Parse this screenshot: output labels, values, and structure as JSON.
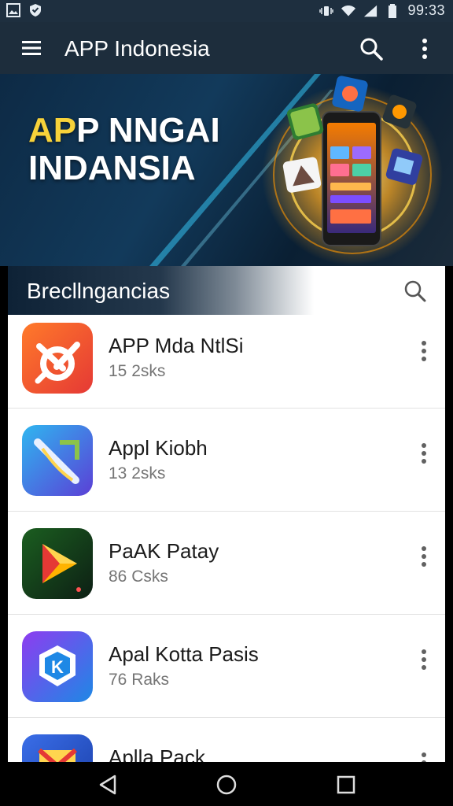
{
  "status_bar": {
    "time": "99:33",
    "icons": [
      "gallery-icon",
      "vpn-shield-icon",
      "vibrate-icon",
      "wifi-icon",
      "signal-icon",
      "battery-icon"
    ]
  },
  "app_bar": {
    "title": "APP Indonesia",
    "menu_icon": "hamburger-menu-icon",
    "search_icon": "search-icon",
    "more_icon": "more-vert-icon"
  },
  "banner": {
    "title_highlight": "AP",
    "title_line1_rest": "P NNGAI",
    "title_line2": "INDANSIA",
    "highlight_color": "#f7d23a"
  },
  "list": {
    "header_title": "Brecllngancias",
    "search_icon": "search-icon",
    "items": [
      {
        "name": "APP Mda NtlSi",
        "sub": "15 2sks",
        "icon_color": "#ef5a1f"
      },
      {
        "name": "Appl Kiobh",
        "sub": "13 2sks",
        "icon_color": "#4a58d8"
      },
      {
        "name": "PaAK Patay",
        "sub": "86 Csks",
        "icon_color": "#1e4a2e"
      },
      {
        "name": "Apal Kotta Pasis",
        "sub": "76 Raks",
        "icon_color": "#6a3ee0"
      },
      {
        "name": "Aplla Pack",
        "sub": "",
        "icon_color": "#2e5fd6"
      }
    ]
  },
  "nav_bar": {
    "icons": [
      "back-icon",
      "home-icon",
      "recents-icon"
    ]
  }
}
